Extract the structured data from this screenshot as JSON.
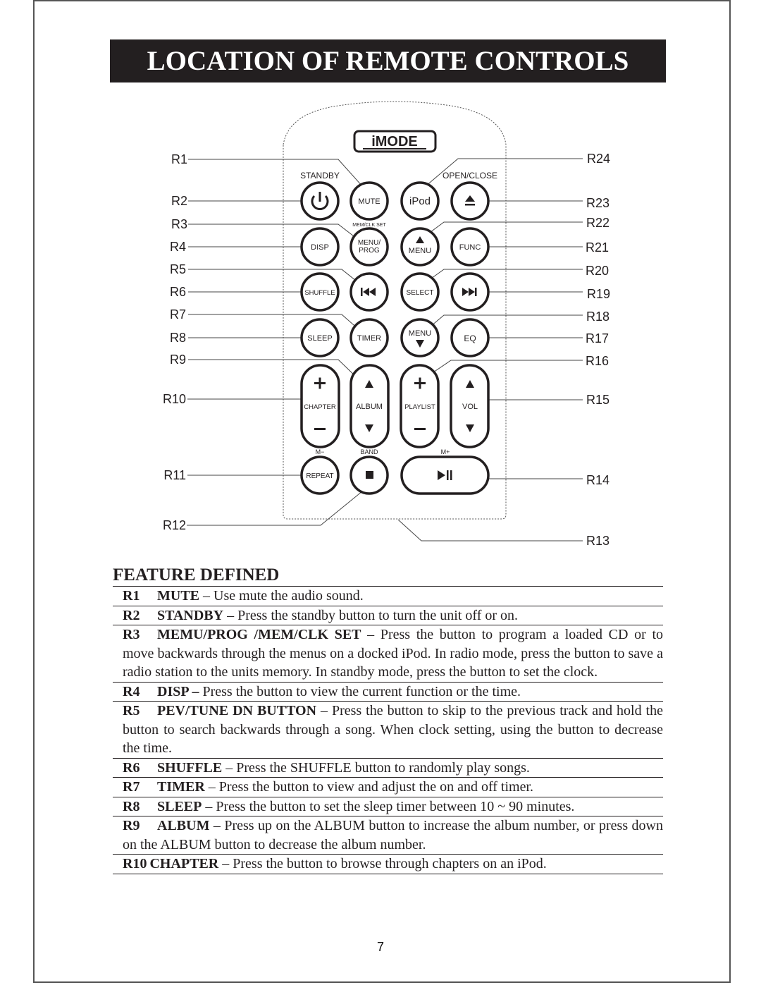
{
  "page": {
    "title": "LOCATION OF REMOTE CONTROLS",
    "page_number": "7"
  },
  "remote": {
    "brand_logo": "iMODE",
    "labels_above": {
      "standby": "STANDBY",
      "open_close": "OPEN/CLOSE",
      "mem_clk_set": "MEM/CLK SET",
      "m_minus": "M−",
      "band": "BAND",
      "m_plus": "M+"
    },
    "buttons": {
      "mute": "MUTE",
      "ipod": "iPod",
      "disp": "DISP",
      "menu_prog_line1": "MENU/",
      "menu_prog_line2": "PROG",
      "menu_up": "MENU",
      "func": "FUNC",
      "shuffle": "SHUFFLE",
      "select": "SELECT",
      "sleep": "SLEEP",
      "timer": "TIMER",
      "menu_down": "MENU",
      "eq": "EQ",
      "chapter": "CHAPTER",
      "album": "ALBUM",
      "playlist": "PLAYLIST",
      "vol": "VOL",
      "repeat": "REPEAT"
    },
    "callouts_left": [
      "R1",
      "R2",
      "R3",
      "R4",
      "R5",
      "R6",
      "R7",
      "R8",
      "R9",
      "R10",
      "R11",
      "R12"
    ],
    "callouts_right": [
      "R24",
      "R23",
      "R22",
      "R21",
      "R20",
      "R19",
      "R18",
      "R17",
      "R16",
      "R15",
      "R14",
      "R13"
    ]
  },
  "features": {
    "heading": "FEATURE DEFINED",
    "items": [
      {
        "id": "R1",
        "name": "MUTE",
        "text": " – Use mute the audio sound."
      },
      {
        "id": "R2",
        "name": "STANDBY",
        "text": " – Press the standby button to turn the unit off or on."
      },
      {
        "id": "R3",
        "name": "MEMU/PROG /MEM/CLK SET",
        "text": " – Press the button to program a loaded CD or to move backwards through the menus on a docked iPod. In radio mode, press the button to save a radio station to the units memory. In standby mode, press the button to set the clock."
      },
      {
        "id": "R4",
        "name": "DISP –",
        "text": " Press the button to view the current function or the time."
      },
      {
        "id": "R5",
        "name": "PEV/TUNE DN BUTTON",
        "text": " – Press the button to skip to the previous track and hold the button to search backwards through a song. When clock setting, using the button to decrease the time."
      },
      {
        "id": "R6",
        "name": "SHUFFLE",
        "text": " – Press the SHUFFLE button to randomly play songs."
      },
      {
        "id": "R7",
        "name": "TIMER",
        "text": " – Press the button to view and adjust the on and off timer."
      },
      {
        "id": "R8",
        "name": "SLEEP",
        "text": " – Press the button to set the sleep timer between 10 ~ 90 minutes."
      },
      {
        "id": "R9",
        "name": "ALBUM",
        "text": " – Press up on the ALBUM button to increase the album number, or press down on the ALBUM button to decrease the album number."
      },
      {
        "id": "R10",
        "name": "CHAPTER",
        "text": " – Press the button to browse through chapters on an iPod."
      }
    ]
  }
}
